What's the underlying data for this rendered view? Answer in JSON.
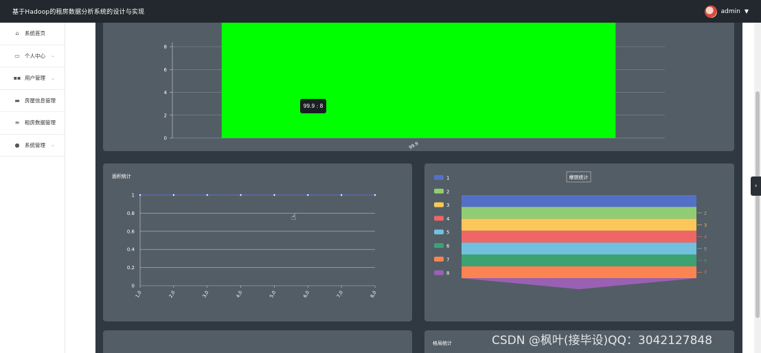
{
  "app": {
    "title": "基于Hadoop的租房数据分析系统的设计与实现",
    "user": "admin"
  },
  "sidebar": {
    "items": [
      {
        "label": "系统首页",
        "icon": "home-icon",
        "has_children": false
      },
      {
        "label": "个人中心",
        "icon": "calendar-icon",
        "has_children": true
      },
      {
        "label": "用户管理",
        "icon": "grid-icon",
        "has_children": true
      },
      {
        "label": "房屋信息管理",
        "icon": "monitor-icon",
        "has_children": false
      },
      {
        "label": "租房数据管理",
        "icon": "sliders-icon",
        "has_children": false
      },
      {
        "label": "系统管理",
        "icon": "pin-icon",
        "has_children": true
      }
    ]
  },
  "tooltip": "99.9 : 8",
  "chart_data": [
    {
      "type": "bar",
      "categories": [
        "99.9"
      ],
      "values": [
        8
      ],
      "ylim": [
        0,
        8
      ],
      "yticks": [
        0,
        2,
        4,
        6,
        8
      ],
      "bar_color": "#00ff00"
    },
    {
      "type": "line",
      "title": "面积统计",
      "x": [
        "1,0",
        "2,0",
        "3,0",
        "4,0",
        "5,0",
        "6,0",
        "7,0",
        "8,0"
      ],
      "values": [
        1,
        1,
        1,
        1,
        1,
        1,
        1,
        1
      ],
      "ylim": [
        0,
        1
      ],
      "yticks": [
        "0",
        "0.2",
        "0.4",
        "0.6",
        "0.8",
        "1"
      ],
      "line_color": "#5b6fd6"
    },
    {
      "type": "funnel",
      "title": "楼层统计",
      "legend": [
        "1",
        "2",
        "3",
        "4",
        "5",
        "6",
        "7",
        "8"
      ],
      "colors": [
        "#5470c6",
        "#91cc75",
        "#fac858",
        "#ee6666",
        "#73c0de",
        "#3ba272",
        "#fc8452",
        "#9a60b4"
      ],
      "right_labels": [
        "",
        "2",
        "3",
        "4",
        "5",
        "6",
        "7"
      ]
    }
  ],
  "bottom_card": {
    "title": "格局统计"
  },
  "watermark": "CSDN @枫叶(接毕设)QQ：3042127848"
}
